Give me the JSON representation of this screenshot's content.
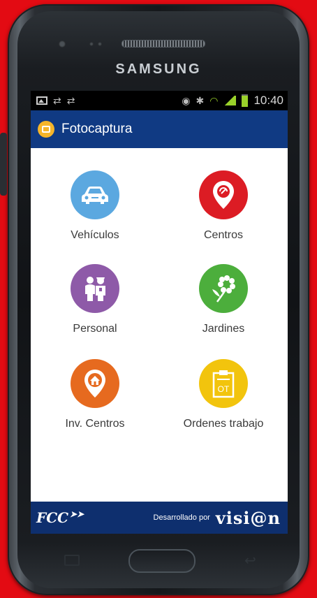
{
  "device": {
    "brand": "SAMSUNG"
  },
  "status_bar": {
    "time": "10:40",
    "left_icons": [
      "image-notification-icon",
      "sync-icon",
      "sync-icon"
    ],
    "right_icons": [
      "eye-icon",
      "bluetooth-icon",
      "wifi-icon",
      "signal-icon",
      "battery-icon"
    ]
  },
  "app": {
    "title": "Fotocaptura",
    "menu": [
      {
        "label": "Vehículos",
        "icon": "car-icon",
        "color": "#5ba8e0"
      },
      {
        "label": "Centros",
        "icon": "location-pin-icon",
        "color": "#dc1c24"
      },
      {
        "label": "Personal",
        "icon": "people-icon",
        "color": "#8e5aa8"
      },
      {
        "label": "Jardines",
        "icon": "flower-icon",
        "color": "#4cae3c"
      },
      {
        "label": "Inv. Centros",
        "icon": "home-pin-icon",
        "color": "#e66a1f"
      },
      {
        "label": "Ordenes trabajo",
        "icon": "clipboard-ot-icon",
        "color": "#f2c40d",
        "badge": "OT"
      }
    ],
    "footer": {
      "left_logo": "FCC",
      "developed_by": "Desarrollado por",
      "right_logo": "visi@n"
    }
  },
  "colors": {
    "appbar": "#103a83",
    "footer": "#0e2f6e",
    "background": "#e30b13"
  }
}
